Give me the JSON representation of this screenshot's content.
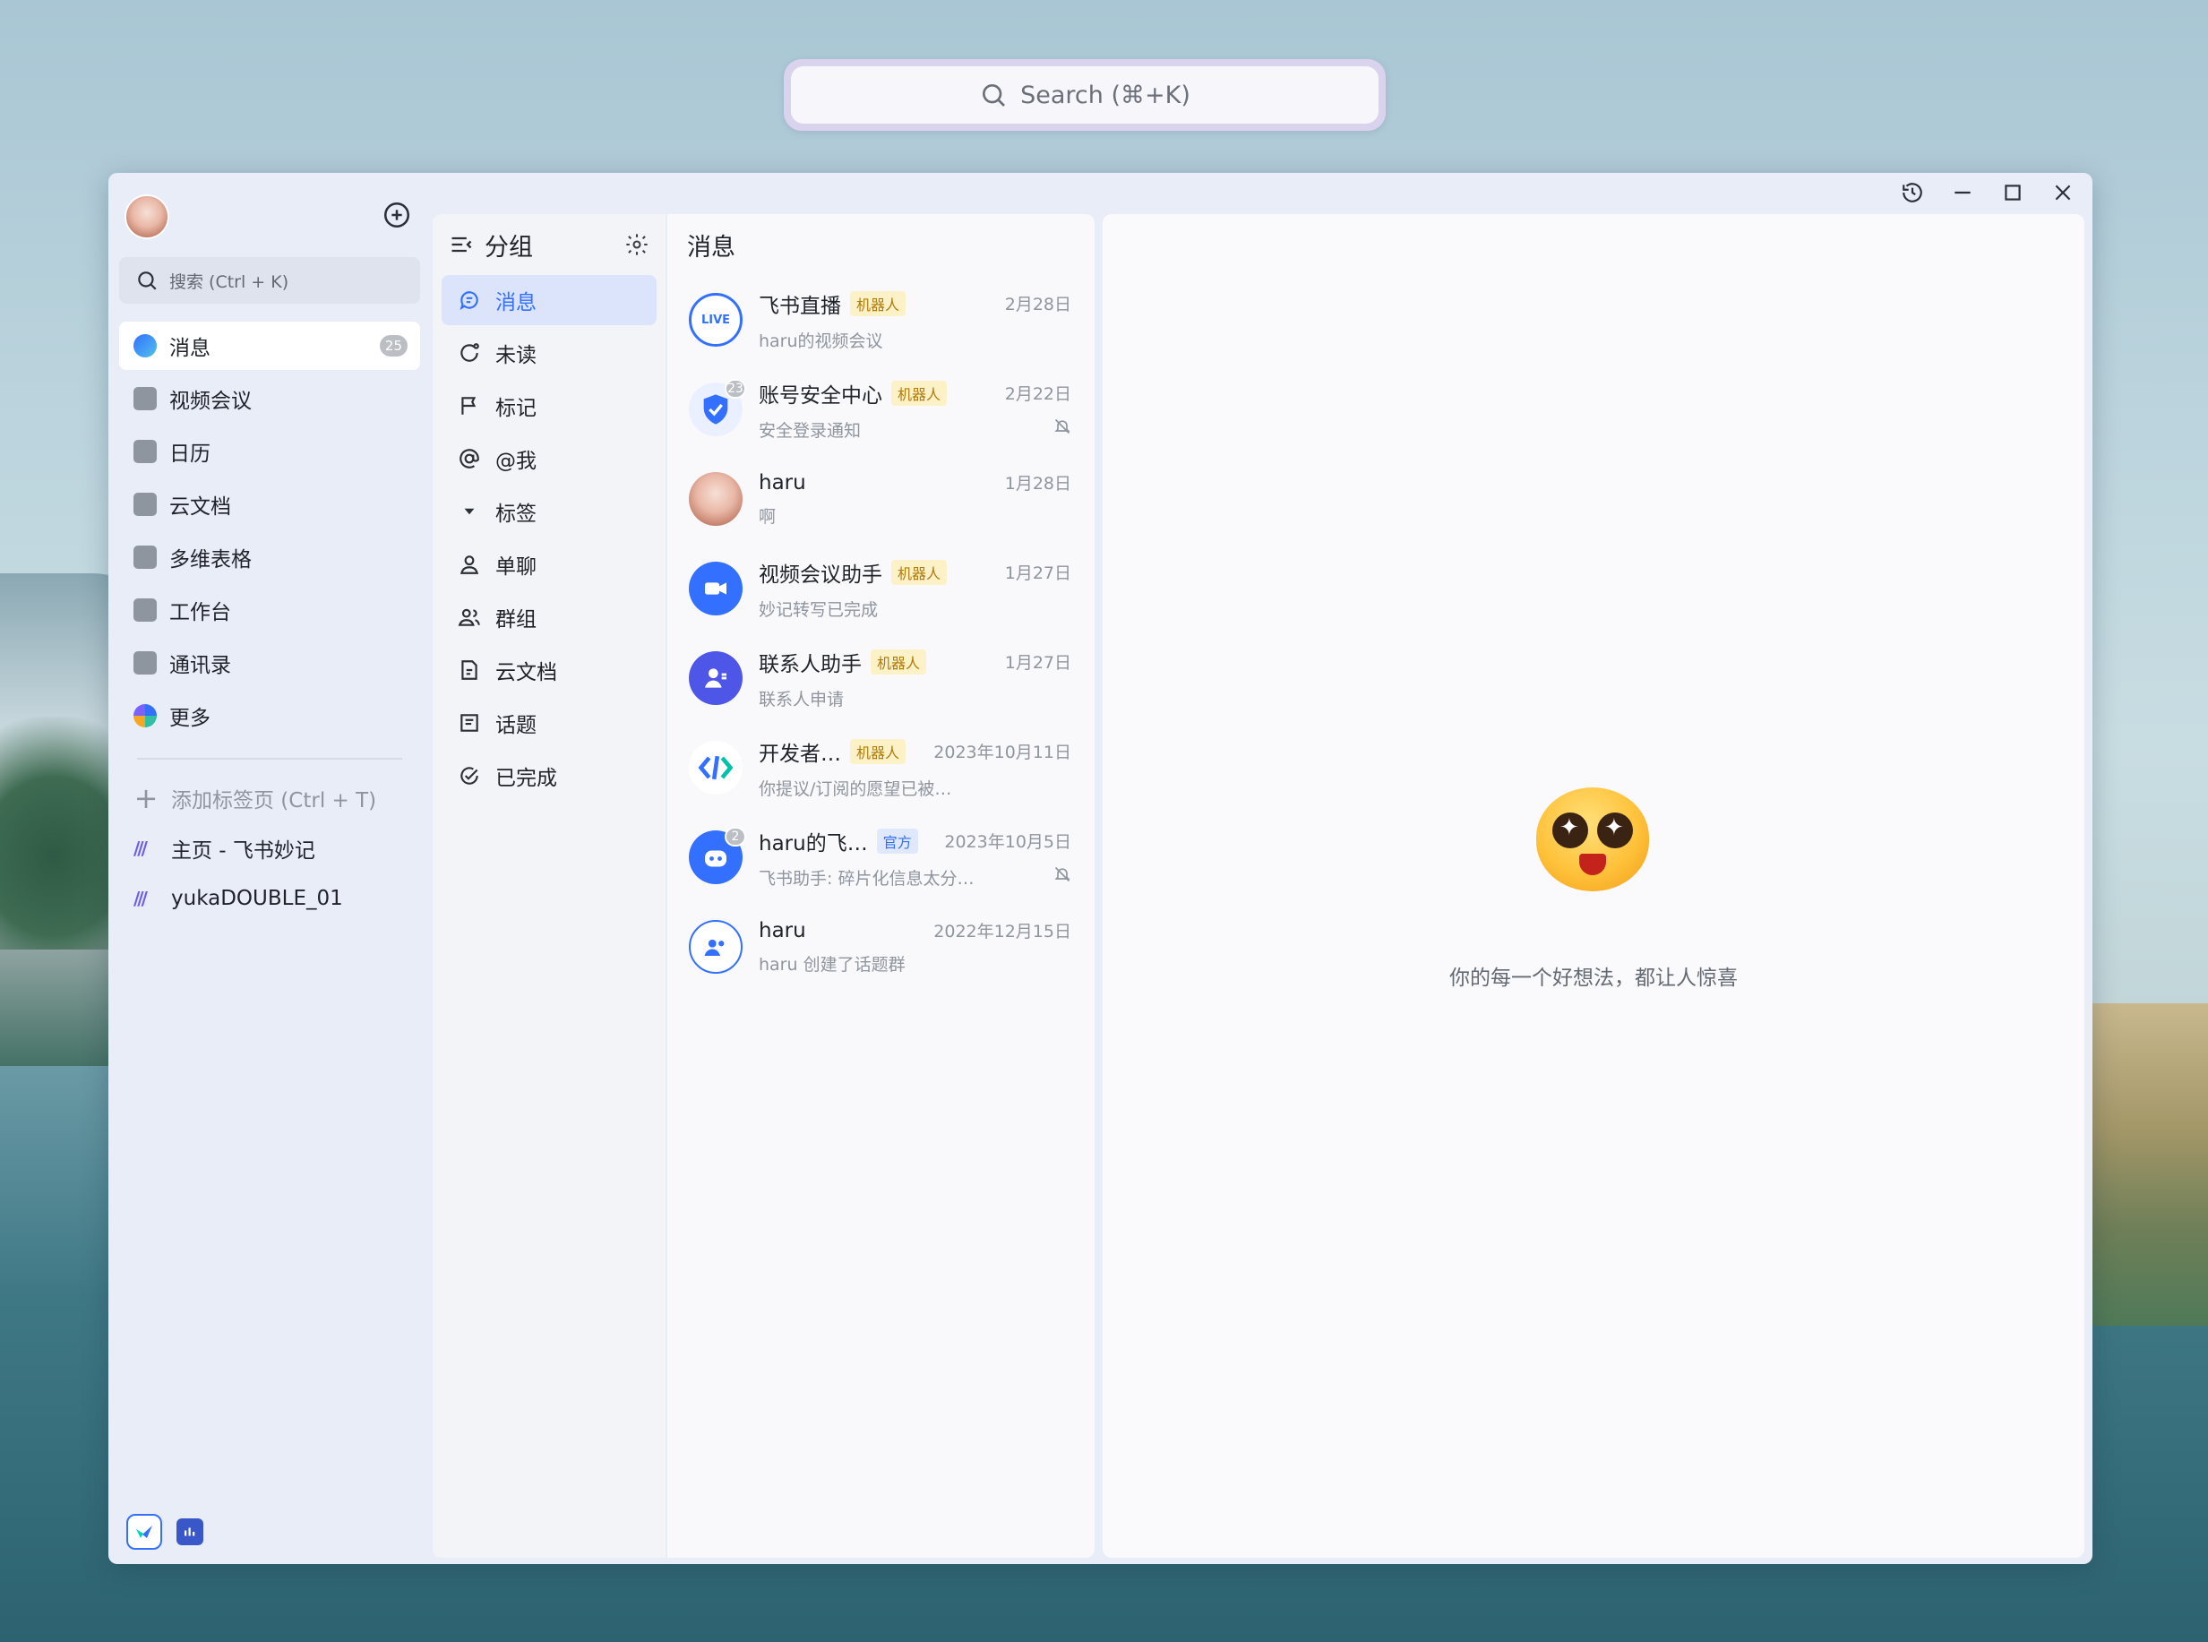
{
  "top_search": {
    "placeholder": "Search (⌘+K)"
  },
  "sidebar": {
    "search_placeholder": "搜索 (Ctrl + K)",
    "items": [
      {
        "label": "消息",
        "badge": "25",
        "icon": "message-icon"
      },
      {
        "label": "视频会议",
        "icon": "video-icon"
      },
      {
        "label": "日历",
        "icon": "calendar-icon"
      },
      {
        "label": "云文档",
        "icon": "docs-icon"
      },
      {
        "label": "多维表格",
        "icon": "bitable-icon"
      },
      {
        "label": "工作台",
        "icon": "workplace-icon"
      },
      {
        "label": "通讯录",
        "icon": "contacts-icon"
      },
      {
        "label": "更多",
        "icon": "more-icon"
      }
    ],
    "tabs": [
      {
        "label": "添加标签页 (Ctrl + T)"
      },
      {
        "label": "主页 - 飞书妙记"
      },
      {
        "label": "yukaDOUBLE_01"
      }
    ]
  },
  "groups": {
    "title": "分组",
    "items": [
      "消息",
      "未读",
      "标记",
      "@我",
      "标签",
      "单聊",
      "群组",
      "云文档",
      "话题",
      "已完成"
    ]
  },
  "messages": {
    "title": "消息",
    "rows": [
      {
        "name": "飞书直播",
        "tag": "机器人",
        "date": "2月28日",
        "sub": "haru的视频会议",
        "color": "#3370ff"
      },
      {
        "name": "账号安全中心",
        "tag": "机器人",
        "date": "2月22日",
        "sub": "安全登录通知",
        "badge": "23",
        "color": "#3370ff"
      },
      {
        "name": "haru",
        "date": "1月28日",
        "sub": "啊",
        "color": "#e4a99a"
      },
      {
        "name": "视频会议助手",
        "tag": "机器人",
        "date": "1月27日",
        "sub": "妙记转写已完成",
        "color": "#3370ff"
      },
      {
        "name": "联系人助手",
        "tag": "机器人",
        "date": "1月27日",
        "sub": "联系人申请",
        "color": "#4e56e8"
      },
      {
        "name": "开发者…",
        "tag": "机器人",
        "date": "2023年10月11日",
        "sub": "你提议/订阅的愿望已被…",
        "color": "#ffffff"
      },
      {
        "name": "haru的飞…",
        "tag": "官方",
        "date": "2023年10月5日",
        "sub": "飞书助手: 碎片化信息太分…",
        "badge": "2",
        "color": "#3370ff"
      },
      {
        "name": "haru",
        "date": "2022年12月15日",
        "sub": "haru 创建了话题群",
        "color": "#ffffff"
      }
    ]
  },
  "pane": {
    "text": "你的每一个好想法，都让人惊喜"
  }
}
